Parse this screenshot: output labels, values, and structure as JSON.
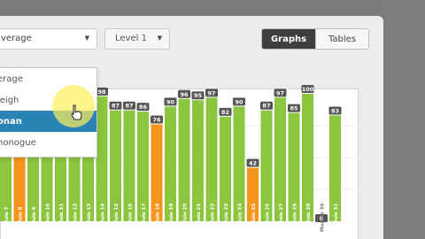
{
  "toolbar": {
    "dropdown_value": "verage",
    "level_value": "Level 1",
    "view_tabs": [
      {
        "label": "Graphs",
        "active": true
      },
      {
        "label": "Tables",
        "active": false
      }
    ]
  },
  "dropdown_menu": {
    "items": [
      {
        "label": "erage",
        "selected": false
      },
      {
        "label": "leigh",
        "selected": false
      },
      {
        "label": "onan",
        "selected": true
      },
      {
        "label": "nonogue",
        "selected": false
      }
    ]
  },
  "colors": {
    "bar_normal": "#8cc63f",
    "bar_highlight": "#f7941d",
    "label_bg": "#555555",
    "menu_selected": "#2a83b5",
    "cursor_halo": "#fff05a"
  },
  "chart_data": {
    "type": "bar",
    "categories": [
      "Module 7",
      "Module 8",
      "Module 9",
      "Module 10",
      "Module 11",
      "Module 12",
      "Module 13",
      "Module 14",
      "Module 15",
      "Module 16",
      "Module 17",
      "Module 18",
      "Module 19",
      "Module 20",
      "Module 21",
      "Module 22",
      "Module 23",
      "Module 24",
      "Module 25",
      "Module 26",
      "Module 27",
      "Module 28",
      "Module 29",
      "Module 30",
      "Module 31"
    ],
    "values": [
      null,
      null,
      null,
      null,
      null,
      null,
      null,
      98,
      87,
      87,
      86,
      76,
      90,
      96,
      95,
      97,
      82,
      90,
      42,
      87,
      97,
      85,
      100,
      0,
      83
    ],
    "highlighted": [
      "Module 8",
      "Module 18",
      "Module 25"
    ],
    "ylim": [
      0,
      100
    ]
  }
}
